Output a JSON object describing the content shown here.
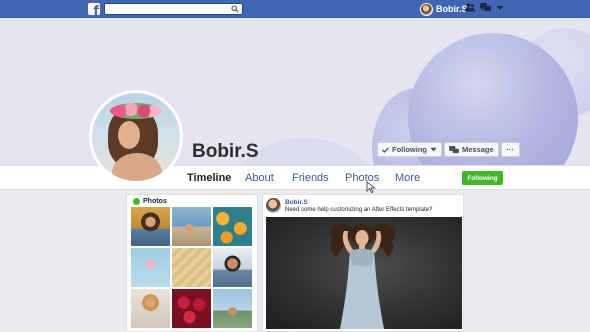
{
  "topbar": {
    "logo_glyph": "f",
    "search_placeholder": "",
    "user_name": "Bobir.S",
    "icons": [
      "friends-icon",
      "messages-icon",
      "dropdown-icon"
    ]
  },
  "profile": {
    "name": "Bobir.S",
    "buttons": {
      "following": "Following",
      "message": "Message",
      "more": "···"
    }
  },
  "nav": {
    "tabs": [
      "Timeline",
      "About",
      "Friends",
      "Photos",
      "More"
    ],
    "active_tab": "Timeline",
    "following_button": "Following"
  },
  "photos": {
    "title": "Photos",
    "count": 9
  },
  "post": {
    "author": "Bobir.S",
    "text": "Need some help customizing an After Effects template?"
  },
  "colors": {
    "topbar": "#4267b2",
    "accent_green": "#42b72a",
    "link": "#385898",
    "cover_balloon": "#a7a9dc"
  }
}
